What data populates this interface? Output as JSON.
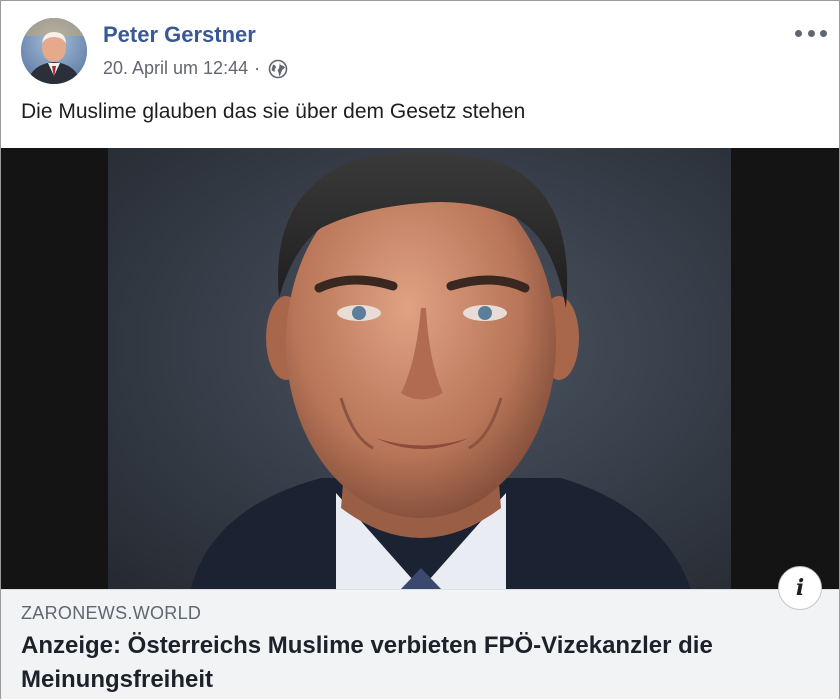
{
  "post": {
    "author": "Peter Gerstner",
    "date": "20. April um 12:44",
    "separator": "·",
    "privacy_icon": "globe-icon",
    "more_icon": "more-options-icon",
    "text": "Die Muslime glauben das sie über dem Gesetz stehen"
  },
  "link_preview": {
    "domain": "ZARONEWS.WORLD",
    "headline": "Anzeige: Österreichs Muslime verbieten FPÖ-Vizekanzler die Meinungsfreiheit",
    "info_label": "i"
  },
  "colors": {
    "author_link": "#385898",
    "meta_text": "#616770",
    "caption_background": "#f2f3f5"
  }
}
